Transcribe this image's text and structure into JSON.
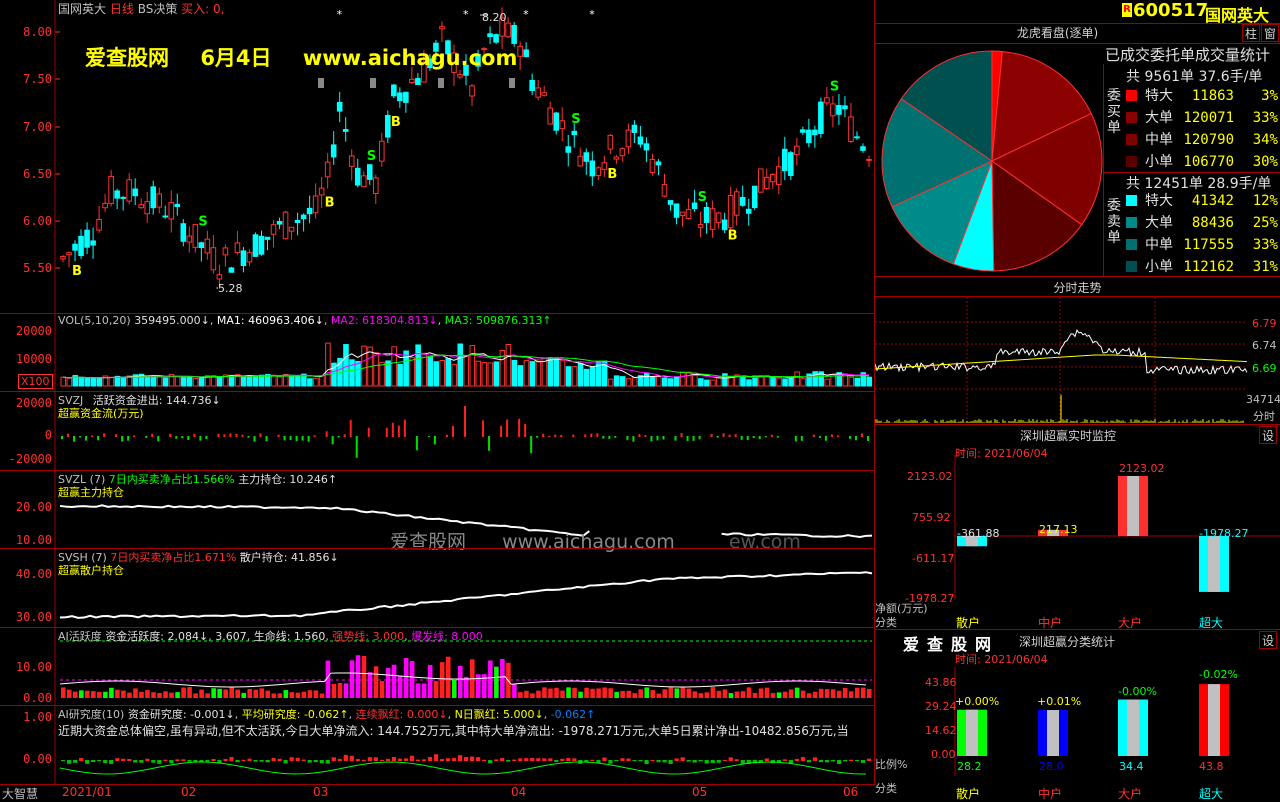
{
  "header": {
    "stock_name": "国网英大",
    "period": "日线",
    "strategy": "BS决策",
    "buy_label": "买入: 0,",
    "high_price": "8.20",
    "low_price": "5.28"
  },
  "watermark": {
    "site": "爱查股网",
    "date": "6月4日",
    "url": "www.aichagu.com",
    "center_site": "爱查股网",
    "center_url": "www.aichagu.com",
    "faint_url": "ew.com"
  },
  "main_ticks": [
    "8.00",
    "7.50",
    "7.00",
    "6.50",
    "6.00",
    "5.50"
  ],
  "vol": {
    "title": "VOL(5,10,20)",
    "value": "359495.000↓",
    "ma1": "MA1: 460963.406↓",
    "ma2": "MA2: 618304.813↓",
    "ma3": "MA3: 509876.313↑",
    "ticks": [
      "20000",
      "10000"
    ],
    "unit": "X100"
  },
  "svzj": {
    "title": "SVZJ",
    "active": "活跃资金进出: 144.736↓",
    "subtitle": "超赢资金流(万元)",
    "ticks": [
      "20000",
      "0",
      "-20000"
    ]
  },
  "svzl": {
    "title": "SVZL (7)",
    "ratio": "7日内买卖净占比1.566%",
    "holding": "主力持仓: 10.246↑",
    "subtitle": "超赢主力持仓",
    "ticks": [
      "20.00",
      "10.00"
    ]
  },
  "svsh": {
    "title": "SVSH (7)",
    "ratio": "7日内买卖净占比1.671%",
    "holding": "散户持仓: 41.856↓",
    "subtitle": "超赢散户持仓",
    "ticks": [
      "40.00",
      "30.00"
    ]
  },
  "ai_active": {
    "title": "AI活跃度",
    "v1": "资金活跃度: 2.084↓",
    "v2": "3.607",
    "v3": "生命线: 1.560",
    "v4": "强势线: 3.000",
    "v5": "爆发线: 8.000",
    "ticks": [
      "10.00",
      "0.00"
    ]
  },
  "ai_research": {
    "title": "AI研究度(10)",
    "v1": "资金研究度: -0.001↓",
    "v2": "平均研究度: -0.062↑",
    "v3": "连续飘红: 0.000↓",
    "v4": "N日飘红: 5.000↓",
    "v5": "-0.062↑",
    "desc": "近期大资金总体偏空,虽有异动,但不太活跃,今日大单净流入: 144.752万元,其中特大单净流出: -1978.271万元,大单5日累计净出-10482.856万元,当",
    "ticks": [
      "1.00",
      "0.00"
    ]
  },
  "x_axis": [
    "2021/01",
    "02",
    "03",
    "04",
    "05",
    "06"
  ],
  "bottom_left": "大智慧",
  "right": {
    "code": "600517",
    "name": "国网英大",
    "r_badge": "R",
    "btn1": "柱",
    "btn2": "窗",
    "dragon_title": "龙虎看盘(逐单)",
    "stat_title": "已成交委托单成交量统计",
    "buy_side": "委买单",
    "sell_side": "委卖单",
    "buy_total": "共 9561单 37.6手/单",
    "sell_total": "共 12451单 28.9手/单",
    "buy_rows": [
      {
        "label": "特大",
        "qty": "11863",
        "pct": "3%",
        "color": "#ff0000"
      },
      {
        "label": "大单",
        "qty": "120071",
        "pct": "33%",
        "color": "#8b0000"
      },
      {
        "label": "中单",
        "qty": "120790",
        "pct": "34%",
        "color": "#800000"
      },
      {
        "label": "小单",
        "qty": "106770",
        "pct": "30%",
        "color": "#5a0000"
      }
    ],
    "sell_rows": [
      {
        "label": "特大",
        "qty": "41342",
        "pct": "12%",
        "color": "#00ffff"
      },
      {
        "label": "大单",
        "qty": "88436",
        "pct": "25%",
        "color": "#008b8b"
      },
      {
        "label": "中单",
        "qty": "117555",
        "pct": "33%",
        "color": "#007070"
      },
      {
        "label": "小单",
        "qty": "112162",
        "pct": "31%",
        "color": "#005050"
      }
    ],
    "intraday_title": "分时走势",
    "intraday_ticks": [
      "6.79",
      "6.74",
      "6.69"
    ],
    "intraday_vol": "34714",
    "intraday_vol_label": "分时",
    "monitor_title": "深圳超赢实时监控",
    "monitor_btn": "设",
    "monitor_time": "时间: 2021/06/04",
    "monitor_ticks": [
      "2123.02",
      "755.92",
      "-611.17",
      "-1978.27"
    ],
    "monitor_unit": "净额(万元)",
    "monitor_cat": "分类",
    "monitor_bars": [
      {
        "name": "散户",
        "value": "-361.88"
      },
      {
        "name": "中户",
        "value": "217.13"
      },
      {
        "name": "大户",
        "value": "2123.02"
      },
      {
        "name": "超大",
        "value": "-1978.27"
      }
    ],
    "class_logo": "爱查股网",
    "class_title": "深圳超赢分类统计",
    "class_btn": "设",
    "class_time": "时间: 2021/06/04",
    "class_ticks": [
      "43.86",
      "29.24",
      "14.62",
      "0.00"
    ],
    "class_unit": "比例%",
    "class_cat": "分类",
    "class_bars": [
      {
        "name": "散户",
        "value": "28.2",
        "delta": "+0.00%",
        "color": "#00ff00"
      },
      {
        "name": "中户",
        "value": "28.0",
        "delta": "+0.01%",
        "color": "#0000ff"
      },
      {
        "name": "大户",
        "value": "34.4",
        "delta": "-0.00%",
        "color": "#00ffff"
      },
      {
        "name": "超大",
        "value": "43.8",
        "delta": "-0.02%",
        "color": "#ff0000"
      }
    ]
  },
  "colors": {
    "up": "#ff3232",
    "down": "#00ffff",
    "border": "#a00000",
    "yellow": "#ffff00"
  }
}
